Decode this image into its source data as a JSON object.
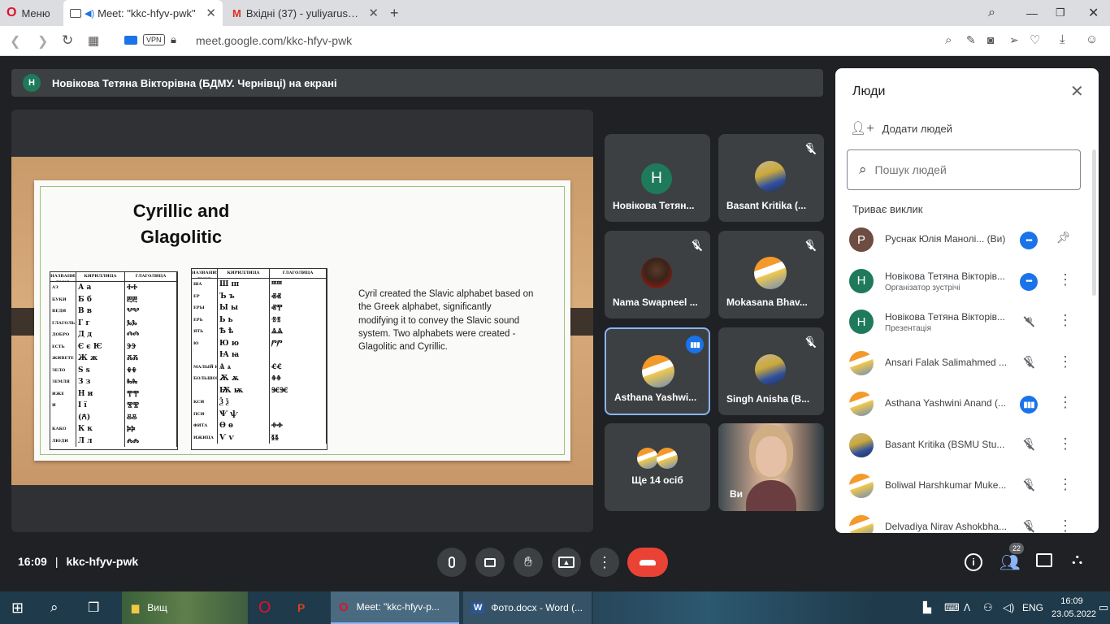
{
  "browser": {
    "menu_label": "Меню",
    "tabs": [
      {
        "title": "Meet: \"kkc-hfyv-pwk\""
      },
      {
        "title": "Вхідні (37) - yuliyarusnak@"
      }
    ],
    "url": "meet.google.com/kkc-hfyv-pwk",
    "vpn_label": "VPN"
  },
  "meet": {
    "presenter_initial": "Н",
    "presenter_banner": "Новікова Тетяна Вікторівна (БДМУ. Чернівці) на екрані",
    "slide": {
      "title_line1": "Cyrillic and",
      "title_line2": "Glagolitic",
      "body": "Cyril created the Slavic alphabet based on the Greek alphabet, significantly modifying it to convey the Slavic sound system. Two alphabets were created - Glagolitic and Cyrillic.",
      "table_left_headers": [
        "НАЗВАНИЯ БУКВ",
        "КИРИЛЛИЦА",
        "ГЛАГОЛИЦА"
      ],
      "table_left_rows": [
        [
          "АЗ",
          "А а",
          "ⰀⰀ"
        ],
        [
          "БУКИ",
          "Б б",
          "ⰁⰁ"
        ],
        [
          "ВЕДИ",
          "В в",
          "ⰂⰂ"
        ],
        [
          "ГЛАГОЛЬ",
          "Г г",
          "ⰃⰃ"
        ],
        [
          "ДОБРО",
          "Д д",
          "ⰄⰄ"
        ],
        [
          "ЕСТЬ",
          "Є є Ѥ",
          "ⰅⰅ"
        ],
        [
          "ЖИВЕТЕ",
          "Ж ж",
          "ⰆⰆ"
        ],
        [
          "ЗЕЛО",
          "Ѕ ѕ",
          "ⰇⰇ"
        ],
        [
          "ЗЕМЛЯ",
          "З з",
          "ⰈⰈ"
        ],
        [
          "ИЖЕ",
          "Н и",
          "ⰉⰉ"
        ],
        [
          "И",
          "І ї",
          "ⰊⰊ"
        ],
        [
          "",
          "(Ꙉ)",
          "ⰋⰋ"
        ],
        [
          "КАКО",
          "К к",
          "ⰍⰍ"
        ],
        [
          "ЛЮДИ",
          "Л л",
          "ⰎⰎ"
        ]
      ],
      "table_right_headers": [
        "НАЗВАНИЯ БУКВ",
        "КИРИЛЛИЦА",
        "ГЛАГОЛИЦА"
      ],
      "table_right_rows": [
        [
          "ША",
          "Ш ш",
          "ⰞⰞ"
        ],
        [
          "ЕР",
          "Ъ ъ",
          "ⰟⰟ"
        ],
        [
          "ЕРЫ",
          "Ы ы",
          "ⰟⰉ"
        ],
        [
          "ЕРЬ",
          "Ь ь",
          "ⰠⰠ"
        ],
        [
          "ЯТЬ",
          "Ѣ ѣ",
          "ⰡⰡ"
        ],
        [
          "Ю",
          "Ю ю",
          "ⰣⰣ"
        ],
        [
          "",
          "Ꙗ ꙗ",
          ""
        ],
        [
          "МАЛЫЙ ЮС",
          "Ѧ ѧ",
          "ⰤⰤ"
        ],
        [
          "БОЛЬШОЙ ЮС",
          "Ѫ ѫ",
          "ⰦⰦ"
        ],
        [
          "",
          "Ѭ ѭ",
          "ⰧⰧ"
        ],
        [
          "КСИ",
          "Ѯ ѯ",
          ""
        ],
        [
          "ПСИ",
          "Ѱ ѱ",
          ""
        ],
        [
          "ФИТА",
          "Ѳ ѳ",
          "ⰪⰪ"
        ],
        [
          "ИЖИЦА",
          "Ѵ ѵ",
          "ⰫⰫ"
        ]
      ]
    },
    "tiles": [
      {
        "name": "Новікова Тетян...",
        "initial": "Н",
        "kind": "letter",
        "mic_off": false
      },
      {
        "name": "Basant Kritika (...",
        "kind": "img",
        "mic_off": true
      },
      {
        "name": "Nama Swapneel ...",
        "kind": "portrait",
        "mic_off": true
      },
      {
        "name": "Mokasana Bhav...",
        "kind": "flag",
        "mic_off": true
      },
      {
        "name": "Asthana Yashwi...",
        "kind": "flag",
        "mic_off": false,
        "speaking": true
      },
      {
        "name": "Singh Anisha (B...",
        "kind": "img",
        "mic_off": true
      },
      {
        "name": "Ще 14 осіб",
        "kind": "more"
      },
      {
        "name": "Ви",
        "kind": "self"
      }
    ],
    "people_panel": {
      "title": "Люди",
      "add_people": "Додати людей",
      "search_placeholder": "Пошук людей",
      "section": "Триває виклик",
      "people": [
        {
          "name": "Руснак Юлія Манолі... (Ви)",
          "sub": "",
          "initial": "Р",
          "avatar": "letter",
          "color": "#6d4c41",
          "state": "more"
        },
        {
          "name": "Новікова Тетяна Вікторів...",
          "sub": "Організатор зустрічі",
          "initial": "Н",
          "avatar": "letter",
          "color": "#1e7a5a",
          "state": "more"
        },
        {
          "name": "Новікова Тетяна Вікторів...",
          "sub": "Презентація",
          "initial": "Н",
          "avatar": "letter",
          "color": "#1e7a5a",
          "state": "present"
        },
        {
          "name": "Ansari Falak Salimahmed ...",
          "sub": "",
          "avatar": "flag",
          "state": "muted"
        },
        {
          "name": "Asthana Yashwini Anand (...",
          "sub": "",
          "avatar": "flag",
          "state": "speaking"
        },
        {
          "name": "Basant Kritika (BSMU Stu...",
          "sub": "",
          "avatar": "img",
          "state": "muted"
        },
        {
          "name": "Boliwal Harshkumar Muke...",
          "sub": "",
          "avatar": "flag",
          "state": "muted"
        },
        {
          "name": "Delvadiya Nirav Ashokbha...",
          "sub": "",
          "avatar": "flag",
          "state": "muted"
        }
      ]
    },
    "bottom": {
      "time": "16:09",
      "separator": "|",
      "meeting_code": "kkc-hfyv-pwk",
      "people_count": "22"
    }
  },
  "taskbar": {
    "items": [
      {
        "label": "Вищ"
      },
      {
        "label": "Meet: \"kkc-hfyv-p..."
      },
      {
        "label": "Фото.docx - Word (..."
      }
    ],
    "lang": "ENG",
    "time": "16:09",
    "date": "23.05.2022"
  },
  "colors": {
    "accent_blue": "#8ab4f8",
    "meet_bg": "#202124",
    "end_call": "#ea4335",
    "tile_bg": "#3c4043"
  }
}
